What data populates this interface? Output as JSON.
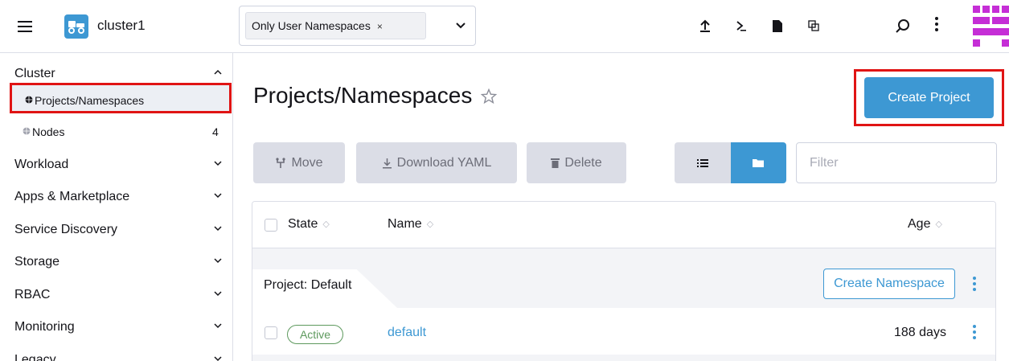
{
  "header": {
    "cluster_name": "cluster1",
    "namespace_filter": {
      "chip_label": "Only User Namespaces",
      "chip_remove": "×"
    },
    "icons": [
      "upload-icon",
      "terminal-icon",
      "file-icon",
      "copy-config-icon",
      "search-icon",
      "more-icon"
    ]
  },
  "sidebar": {
    "groups": [
      {
        "label": "Cluster",
        "expanded": true
      },
      {
        "label": "Workload"
      },
      {
        "label": "Apps & Marketplace"
      },
      {
        "label": "Service Discovery"
      },
      {
        "label": "Storage"
      },
      {
        "label": "RBAC"
      },
      {
        "label": "Monitoring"
      },
      {
        "label": "Legacy"
      }
    ],
    "cluster_items": [
      {
        "label": "Projects/Namespaces",
        "active": true
      },
      {
        "label": "Nodes",
        "count": "4"
      }
    ]
  },
  "main": {
    "title": "Projects/Namespaces",
    "create_project_label": "Create Project",
    "toolbar": {
      "move_label": "Move",
      "download_label": "Download YAML",
      "delete_label": "Delete",
      "filter_placeholder": "Filter"
    },
    "table": {
      "columns": [
        "State",
        "Name",
        "Age"
      ],
      "groups": [
        {
          "label": "Project: Default",
          "create_namespace_label": "Create Namespace",
          "rows": [
            {
              "state": "Active",
              "name": "default",
              "age": "188 days"
            }
          ]
        }
      ]
    }
  },
  "colors": {
    "accent": "#3d98d3",
    "highlight_border": "#e01414",
    "active_state": "#5d995d",
    "disabled_button": "#dbdde6"
  }
}
